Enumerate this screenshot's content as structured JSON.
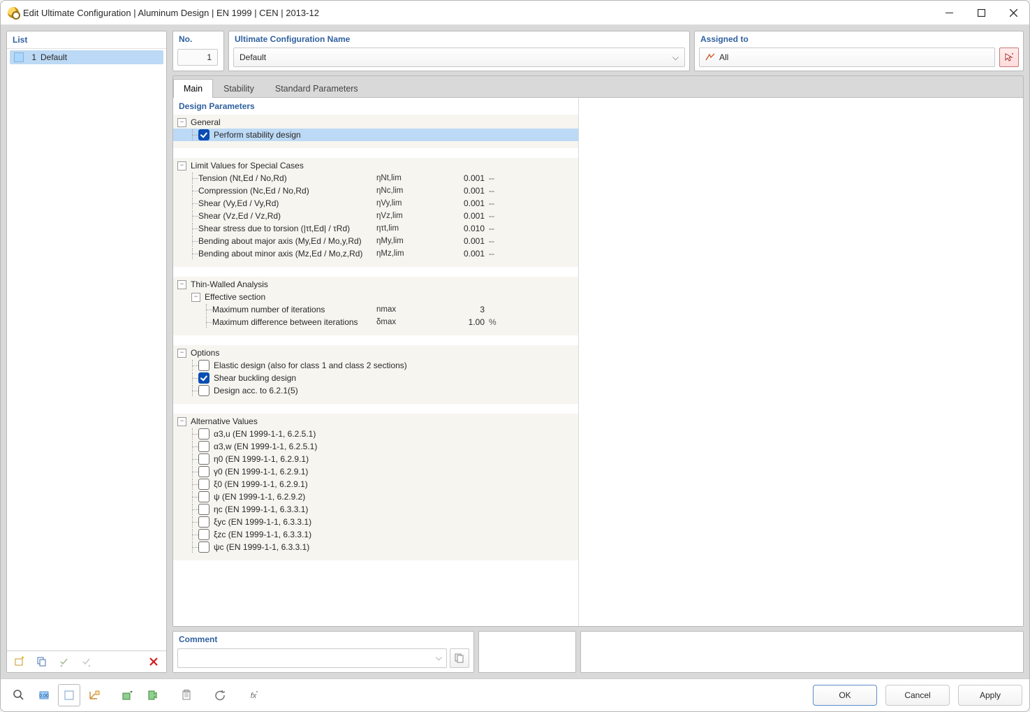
{
  "window": {
    "title": "Edit Ultimate Configuration | Aluminum Design | EN 1999 | CEN | 2013-12"
  },
  "left": {
    "title": "List",
    "items": [
      {
        "num": "1",
        "label": "Default"
      }
    ]
  },
  "top": {
    "no_label": "No.",
    "no_value": "1",
    "name_label": "Ultimate Configuration Name",
    "name_value": "Default",
    "assigned_label": "Assigned to",
    "assigned_value": "All"
  },
  "tabs": [
    "Main",
    "Stability",
    "Standard Parameters"
  ],
  "section_title": "Design Parameters",
  "groups": {
    "general": {
      "title": "General",
      "stability": "Perform stability design"
    },
    "limits": {
      "title": "Limit Values for Special Cases",
      "rows": [
        {
          "name": "Tension (Nt,Ed / No,Rd)",
          "sym": "ηNt,lim",
          "val": "0.001",
          "unit": "--"
        },
        {
          "name": "Compression (Nc,Ed / No,Rd)",
          "sym": "ηNc,lim",
          "val": "0.001",
          "unit": "--"
        },
        {
          "name": "Shear (Vy,Ed / Vy,Rd)",
          "sym": "ηVy,lim",
          "val": "0.001",
          "unit": "--"
        },
        {
          "name": "Shear (Vz,Ed / Vz,Rd)",
          "sym": "ηVz,lim",
          "val": "0.001",
          "unit": "--"
        },
        {
          "name": "Shear stress due to torsion (|τt,Ed| / τRd)",
          "sym": "ητt,lim",
          "val": "0.010",
          "unit": "--"
        },
        {
          "name": "Bending about major axis (My,Ed / Mo,y,Rd)",
          "sym": "ηMy,lim",
          "val": "0.001",
          "unit": "--"
        },
        {
          "name": "Bending about minor axis (Mz,Ed / Mo,z,Rd)",
          "sym": "ηMz,lim",
          "val": "0.001",
          "unit": "--"
        }
      ]
    },
    "thin": {
      "title": "Thin-Walled Analysis",
      "sub": "Effective section",
      "rows": [
        {
          "name": "Maximum number of iterations",
          "sym": "nmax",
          "val": "3",
          "unit": ""
        },
        {
          "name": "Maximum difference between iterations",
          "sym": "δmax",
          "val": "1.00",
          "unit": "%"
        }
      ]
    },
    "options": {
      "title": "Options",
      "items": [
        {
          "label": "Elastic design (also for class 1 and class 2 sections)",
          "checked": false
        },
        {
          "label": "Shear buckling design",
          "checked": true
        },
        {
          "label": "Design acc. to 6.2.1(5)",
          "checked": false
        }
      ]
    },
    "alt": {
      "title": "Alternative Values",
      "items": [
        "α3,u (EN 1999-1-1, 6.2.5.1)",
        "α3,w (EN 1999-1-1, 6.2.5.1)",
        "η0 (EN 1999-1-1, 6.2.9.1)",
        "γ0 (EN 1999-1-1, 6.2.9.1)",
        "ξ0 (EN 1999-1-1, 6.2.9.1)",
        "ψ (EN 1999-1-1, 6.2.9.2)",
        "ηc (EN 1999-1-1, 6.3.3.1)",
        "ξyc (EN 1999-1-1, 6.3.3.1)",
        "ξzc (EN 1999-1-1, 6.3.3.1)",
        "ψc (EN 1999-1-1, 6.3.3.1)"
      ]
    }
  },
  "comment_label": "Comment",
  "buttons": {
    "ok": "OK",
    "cancel": "Cancel",
    "apply": "Apply"
  }
}
